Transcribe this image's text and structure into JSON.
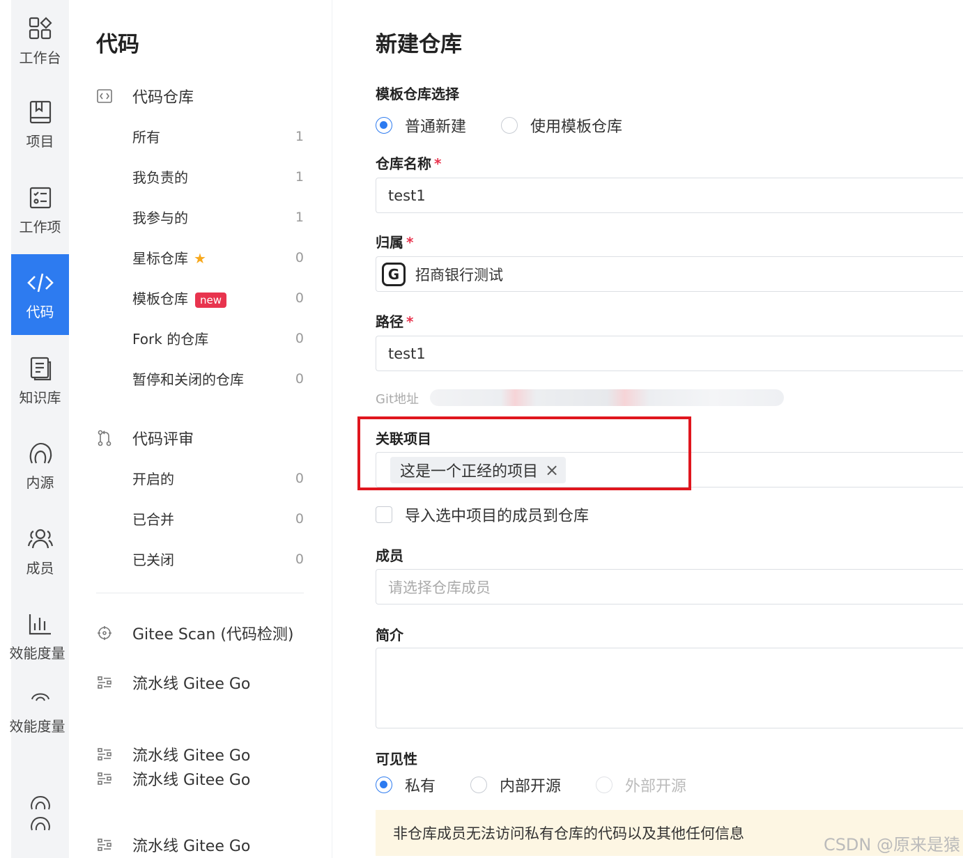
{
  "rail": {
    "items": [
      {
        "label": "工作台",
        "icon": "dashboard-icon"
      },
      {
        "label": "项目",
        "icon": "project-icon"
      },
      {
        "label": "工作项",
        "icon": "tasklist-icon"
      },
      {
        "label": "代码",
        "icon": "code-icon"
      },
      {
        "label": "知识库",
        "icon": "document-icon"
      },
      {
        "label": "内源",
        "icon": "innersource-icon"
      },
      {
        "label": "成员",
        "icon": "members-icon"
      },
      {
        "label": "效能度量",
        "icon": "bar-chart-icon"
      },
      {
        "label": "效能度量",
        "icon": "metric-icon"
      }
    ]
  },
  "nav": {
    "title": "代码",
    "repo_section": "代码仓库",
    "repo_items": [
      {
        "label": "所有",
        "count": "1"
      },
      {
        "label": "我负责的",
        "count": "1"
      },
      {
        "label": "我参与的",
        "count": "1"
      },
      {
        "label": "星标仓库",
        "count": "0"
      },
      {
        "label": "模板仓库",
        "count": "0",
        "badge": "new"
      },
      {
        "label": "Fork 的仓库",
        "count": "0"
      },
      {
        "label": "暂停和关闭的仓库",
        "count": "0"
      }
    ],
    "review_section": "代码评审",
    "review_items": [
      {
        "label": "开启的",
        "count": "0"
      },
      {
        "label": "已合并",
        "count": "0"
      },
      {
        "label": "已关闭",
        "count": "0"
      }
    ],
    "tools": [
      "Gitee Scan (代码检测)",
      "流水线 Gitee Go",
      "流水线 Gitee Go",
      "流水线 Gitee Go",
      "流水线 Gitee Go"
    ]
  },
  "form": {
    "title": "新建仓库",
    "template_label": "模板仓库选择",
    "template_options": [
      "普通新建",
      "使用模板仓库"
    ],
    "name_label": "仓库名称",
    "name_value": "test1",
    "owner_label": "归属",
    "owner_value": "招商银行测试",
    "path_label": "路径",
    "path_value": "test1",
    "git_label": "Git地址",
    "project_label": "关联项目",
    "project_tag": "这是一个正经的项目",
    "import_members_label": "导入选中项目的成员到仓库",
    "members_label": "成员",
    "members_placeholder": "请选择仓库成员",
    "intro_label": "简介",
    "visibility_label": "可见性",
    "visibility_options": [
      "私有",
      "内部开源",
      "外部开源"
    ],
    "notice": "非仓库成员无法访问私有仓库的代码以及其他任何信息"
  },
  "watermark": "CSDN @原来是猿",
  "colors": {
    "accent": "#2d7bf0",
    "required": "#e8344e",
    "highlight": "#e0161e",
    "notice_bg": "#fdf6e3"
  }
}
